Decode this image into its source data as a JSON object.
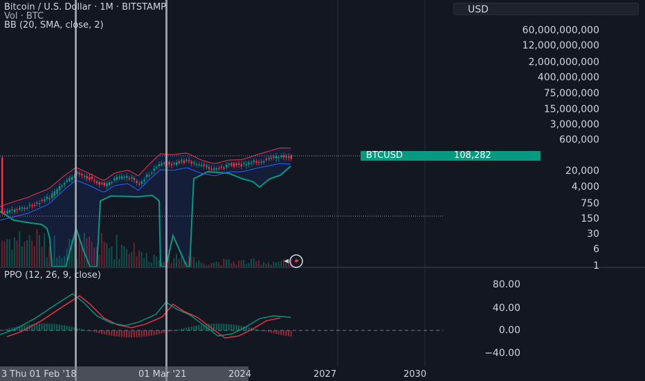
{
  "header": {
    "title": "Bitcoin / U.S. Dollar · 1M · BITSTAMP",
    "vol": "Vol · BTC",
    "bb": "BB (20, SMA, close, 2)"
  },
  "currency": "USD",
  "price_axis": [
    "60,000,000,000",
    "12,000,000,000",
    "2,000,000,000",
    "400,000,000",
    "75,000,000",
    "15,000,000",
    "3,000,000",
    "600,000",
    "20,000",
    "4,000",
    "750",
    "150",
    "30",
    "6",
    "1"
  ],
  "price_tag": {
    "symbol": "BTCUSD",
    "price": "108,282"
  },
  "ppo": {
    "label": "PPO (12, 26, 9, close)",
    "axis": [
      "80.00",
      "40.00",
      "0.00",
      "−40.00"
    ]
  },
  "time_axis": [
    "3",
    "Thu 01 Feb '18",
    "01 Mar '21",
    "2024",
    "2027",
    "2030"
  ],
  "colors": {
    "background": "#131722",
    "up": "#089981",
    "down": "#f23645",
    "bb_basis": "#2962ff",
    "bb_band": "#f23645",
    "ppo_line": "#089981",
    "ppo_signal": "#f23645",
    "grid": "#2a2e39"
  },
  "icons": {
    "replay": "lightning-icon"
  }
}
